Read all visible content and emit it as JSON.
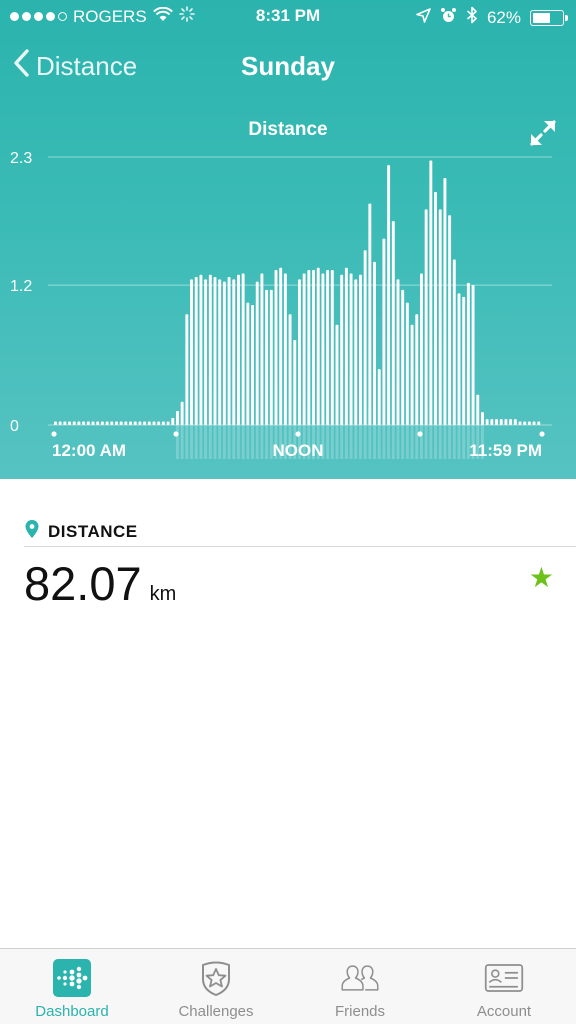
{
  "status_bar": {
    "carrier": "ROGERS",
    "time": "8:31 PM",
    "battery_percent": "62%",
    "battery_level": 0.62,
    "signal_bars_filled": 4,
    "signal_bars_total": 5
  },
  "nav": {
    "back_label": "Distance",
    "title": "Sunday"
  },
  "chart_header": {
    "title": "Distance"
  },
  "chart_data": {
    "type": "bar",
    "title": "Distance",
    "y_ticks": [
      "2.3",
      "1.2",
      "0"
    ],
    "ylim": [
      0,
      2.3
    ],
    "grid": true,
    "x_tick_labels": [
      "12:00 AM",
      "NOON",
      "11:59 PM"
    ],
    "bar_color": "#ffffff",
    "values": [
      0.03,
      0.03,
      0.03,
      0.03,
      0.03,
      0.03,
      0.03,
      0.03,
      0.03,
      0.03,
      0.03,
      0.03,
      0.03,
      0.03,
      0.03,
      0.03,
      0.03,
      0.03,
      0.03,
      0.03,
      0.03,
      0.03,
      0.03,
      0.03,
      0.03,
      0.06,
      0.12,
      0.2,
      0.95,
      1.25,
      1.27,
      1.29,
      1.25,
      1.29,
      1.27,
      1.25,
      1.23,
      1.27,
      1.25,
      1.29,
      1.3,
      1.05,
      1.03,
      1.23,
      1.3,
      1.16,
      1.16,
      1.33,
      1.35,
      1.3,
      0.95,
      0.73,
      1.25,
      1.3,
      1.33,
      1.33,
      1.35,
      1.3,
      1.33,
      1.33,
      0.86,
      1.29,
      1.35,
      1.3,
      1.25,
      1.29,
      1.5,
      1.9,
      1.4,
      0.48,
      1.6,
      2.23,
      1.75,
      1.25,
      1.16,
      1.05,
      0.86,
      0.95,
      1.3,
      1.85,
      2.27,
      2.0,
      1.85,
      2.12,
      1.8,
      1.42,
      1.13,
      1.1,
      1.22,
      1.2,
      0.26,
      0.11,
      0.05,
      0.05,
      0.05,
      0.05,
      0.05,
      0.05,
      0.05,
      0.03,
      0.03,
      0.03,
      0.03,
      0.03
    ]
  },
  "metric": {
    "icon": "location-pin-icon",
    "label": "DISTANCE",
    "value": "82.07",
    "unit": "km",
    "star_color": "#6cc11a"
  },
  "accent_color": "#2bb3ad",
  "tabs": [
    {
      "label": "Dashboard",
      "icon": "dashboard-icon",
      "active": true
    },
    {
      "label": "Challenges",
      "icon": "challenges-star-badge-icon",
      "active": false
    },
    {
      "label": "Friends",
      "icon": "friends-icon",
      "active": false
    },
    {
      "label": "Account",
      "icon": "account-card-icon",
      "active": false
    }
  ]
}
